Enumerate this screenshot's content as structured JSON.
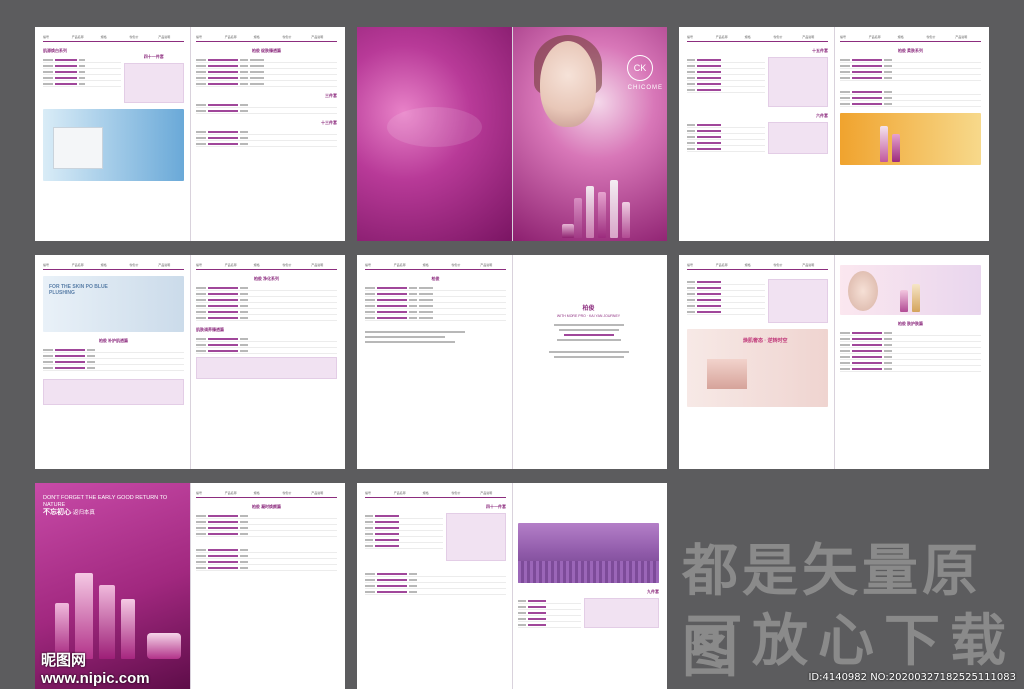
{
  "brand": {
    "name": "CHICOME",
    "mark": "CK"
  },
  "table_header": [
    "编号",
    "产品名称",
    "规格",
    "零售价",
    "产品说明"
  ],
  "pages": {
    "p1_title": "肌源焕白系列",
    "p1_sub": "四十一件套",
    "p1_right_title": "柏俊 绽肤臻透篇",
    "p1_right_sub1": "三件套",
    "p1_right_sub2": "十三件套",
    "p2_title": "柏俊 净化系列",
    "p2_sub": "肌肤调养臻透篇",
    "p3_title": "柏俊 柔肤系列",
    "p3_sub": "十五件套",
    "p3_sub2": "六件套",
    "p4_banner_title": "FOR THE SKIN PO BLUE PLUSHING",
    "p4_title": "柏俊 补护肌透篇",
    "p5_left_title": "柏俊",
    "p5_left_sub": "WITH MORE PRO · KAI YAN JOURNEY",
    "p6_title": "柏俊 肤护肤篇",
    "p6_banner_title": "焕肌奢态 · 逆转时空",
    "p7_lead": "DON'T FORGET THE EARLY GOOD RETURN TO NATURE",
    "p7_lead_cn": "不忘初心",
    "p7_lead_cn2": "·返归本真",
    "p7_right_title": "柏俊 凝时焕颜篇",
    "p8_title": "四十一件套",
    "p8_sub": "九件套"
  },
  "watermark": {
    "line1": "都是矢量原图",
    "line2": "可放心下载"
  },
  "footer": {
    "logo": "昵图网 www.nipic.com",
    "id": "ID:4140982 NO:20200327182525111083"
  },
  "colors": {
    "accent": "#8e2f80",
    "bg": "#5c5c5e"
  }
}
